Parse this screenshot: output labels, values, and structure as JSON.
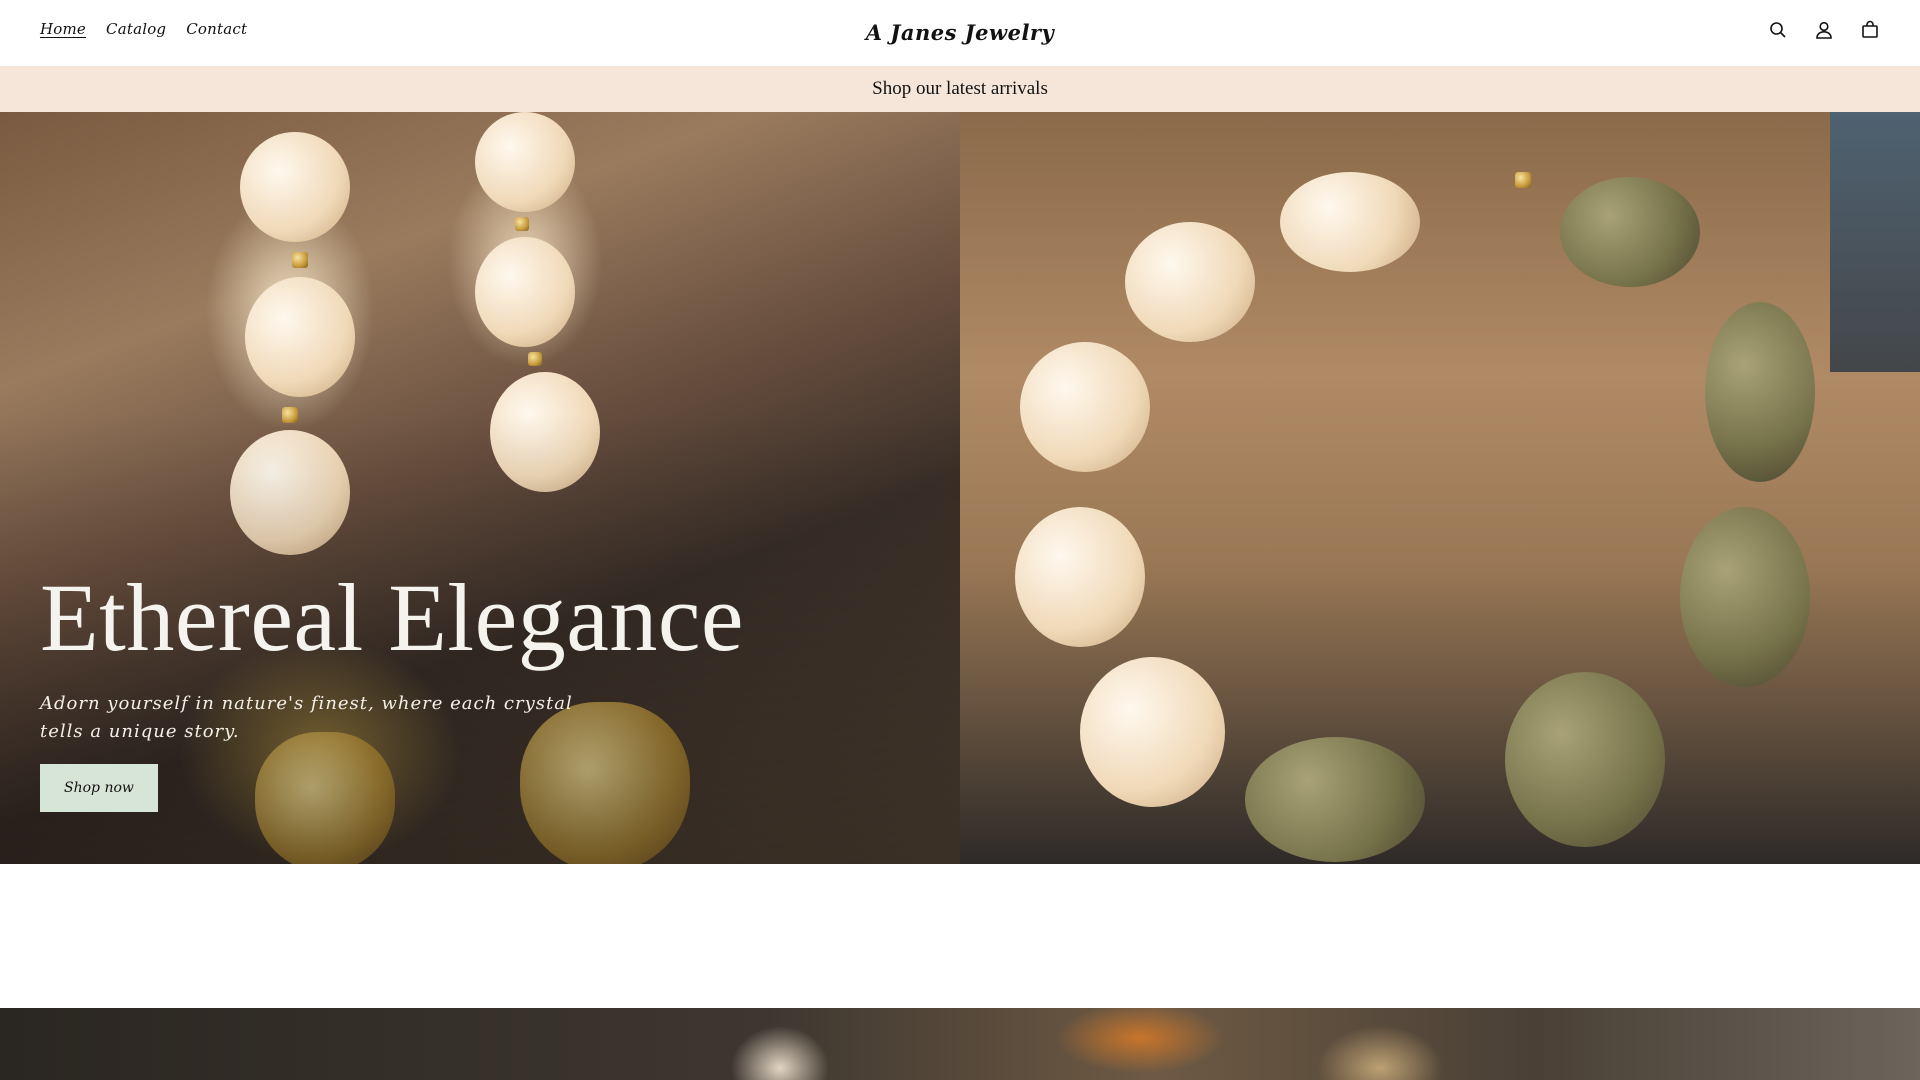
{
  "header": {
    "nav": [
      {
        "label": "Home"
      },
      {
        "label": "Catalog"
      },
      {
        "label": "Contact"
      }
    ],
    "logo": "A Janes Jewelry",
    "icons": [
      "search-icon",
      "account-icon",
      "cart-icon"
    ]
  },
  "announcement": {
    "text": "Shop our latest arrivals"
  },
  "hero": {
    "title": "Ethereal Elegance",
    "subtitle": "Adorn yourself in nature's finest, where each crystal tells a unique story.",
    "button_label": "Shop now"
  },
  "colors": {
    "announcement_bg": "#f5e6d9",
    "button_bg": "#d6e5d6",
    "text": "#121212"
  }
}
